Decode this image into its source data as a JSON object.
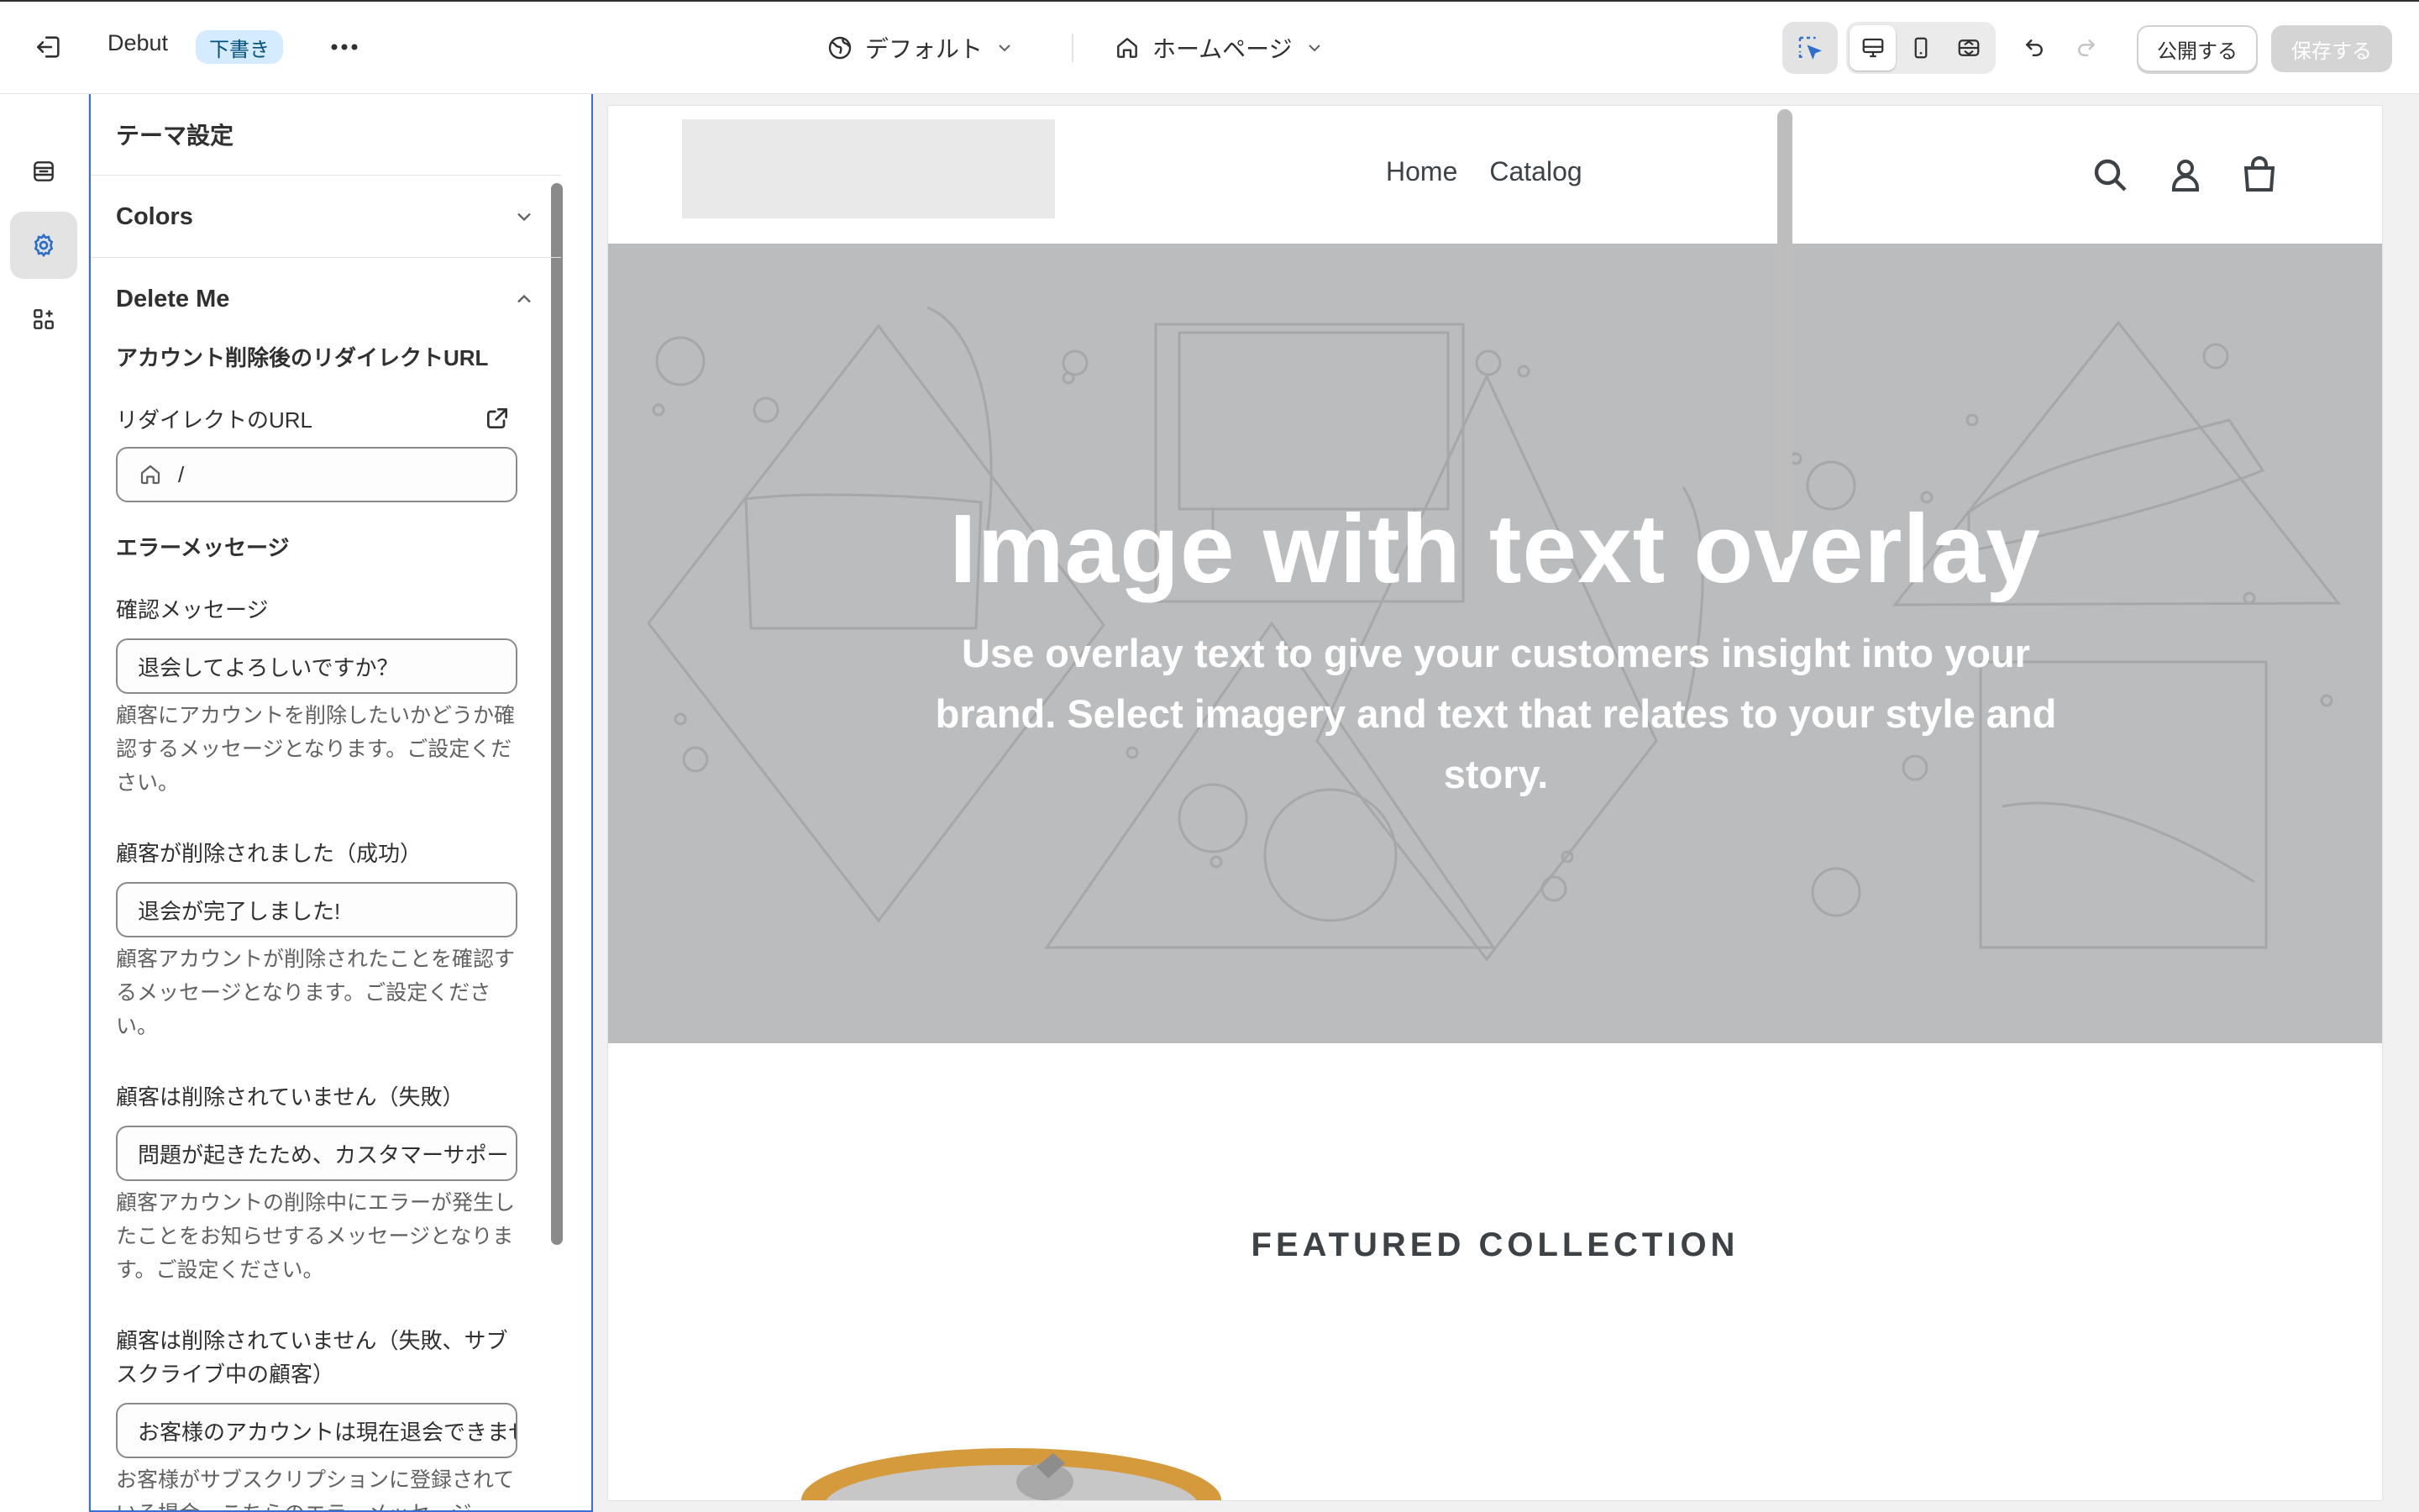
{
  "topbar": {
    "theme_name": "Debut",
    "status_badge": "下書き",
    "preset": "デフォルト",
    "page": "ホームページ",
    "publish_label": "公開する",
    "save_label": "保存する"
  },
  "panel": {
    "title": "テーマ設定",
    "sections": {
      "colors": "Colors",
      "delete_me": "Delete Me"
    },
    "redirect_heading": "アカウント削除後のリダイレクトURL",
    "redirect_label": "リダイレクトのURL",
    "redirect_value": "/",
    "error_heading": "エラーメッセージ",
    "fields": [
      {
        "label": "確認メッセージ",
        "value": "退会してよろしいですか？",
        "help": "顧客にアカウントを削除したいかどうか確認するメッセージとなります。ご設定ください。"
      },
      {
        "label": "顧客が削除されました（成功）",
        "value": "退会が完了しました!",
        "help": "顧客アカウントが削除されたことを確認するメッセージとなります。ご設定ください。"
      },
      {
        "label": "顧客は削除されていません（失敗）",
        "value": "問題が起きたため、カスタマーサポートにご連絡ください",
        "help": "顧客アカウントの削除中にエラーが発生したことをお知らせするメッセージとなります。ご設定ください。"
      },
      {
        "label": "顧客は削除されていません（失敗、サブスクライブ中の顧客）",
        "value": "お客様のアカウントは現在退会できません",
        "help": "お客様がサブスクリプションに登録されている場合、こちらのエラーメッセージ"
      }
    ]
  },
  "preview": {
    "nav": [
      "Home",
      "Catalog"
    ],
    "hero_title": "Image with text overlay",
    "hero_text": "Use overlay text to give your customers insight into your brand. Select imagery and text that relates to your style and story.",
    "featured_title": "FEATURED COLLECTION"
  },
  "colors": {
    "accent_blue": "#3b6fd8",
    "badge_bg": "#d5ebff",
    "hero_bg": "#bbbcbe"
  }
}
